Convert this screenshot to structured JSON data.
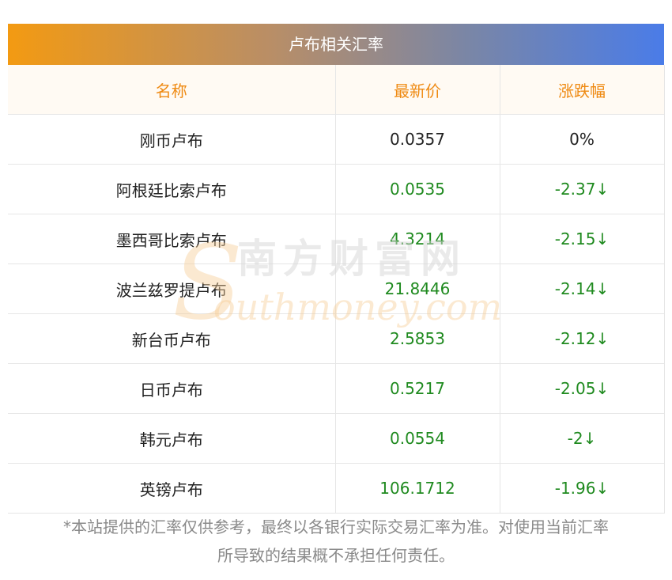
{
  "title": "卢布相关汇率",
  "headers": {
    "name": "名称",
    "price": "最新价",
    "change": "涨跌幅"
  },
  "rows": [
    {
      "name": "刚币卢布",
      "price": "0.0357",
      "change": "0%",
      "dir": "flat"
    },
    {
      "name": "阿根廷比索卢布",
      "price": "0.0535",
      "change": "-2.37↓",
      "dir": "down"
    },
    {
      "name": "墨西哥比索卢布",
      "price": "4.3214",
      "change": "-2.15↓",
      "dir": "down"
    },
    {
      "name": "波兰兹罗提卢布",
      "price": "21.8446",
      "change": "-2.14↓",
      "dir": "down"
    },
    {
      "name": "新台币卢布",
      "price": "2.5853",
      "change": "-2.12↓",
      "dir": "down"
    },
    {
      "name": "日币卢布",
      "price": "0.5217",
      "change": "-2.05↓",
      "dir": "down"
    },
    {
      "name": "韩元卢布",
      "price": "0.0554",
      "change": "-2↓",
      "dir": "down"
    },
    {
      "name": "英镑卢布",
      "price": "106.1712",
      "change": "-1.96↓",
      "dir": "down"
    }
  ],
  "watermark": {
    "cn": "南方财富网",
    "en": "outhmoney.com"
  },
  "disclaimer": {
    "line1": "*本站提供的汇率仅供参考，最终以各银行实际交易汇率为准。对使用当前汇率",
    "line2": "所导致的结果概不承担任何责任。"
  },
  "colors": {
    "header_text": "#ef8a12",
    "down": "#1f8a1f",
    "gradient_start": "#f39a12",
    "gradient_end": "#4a7ce8"
  }
}
